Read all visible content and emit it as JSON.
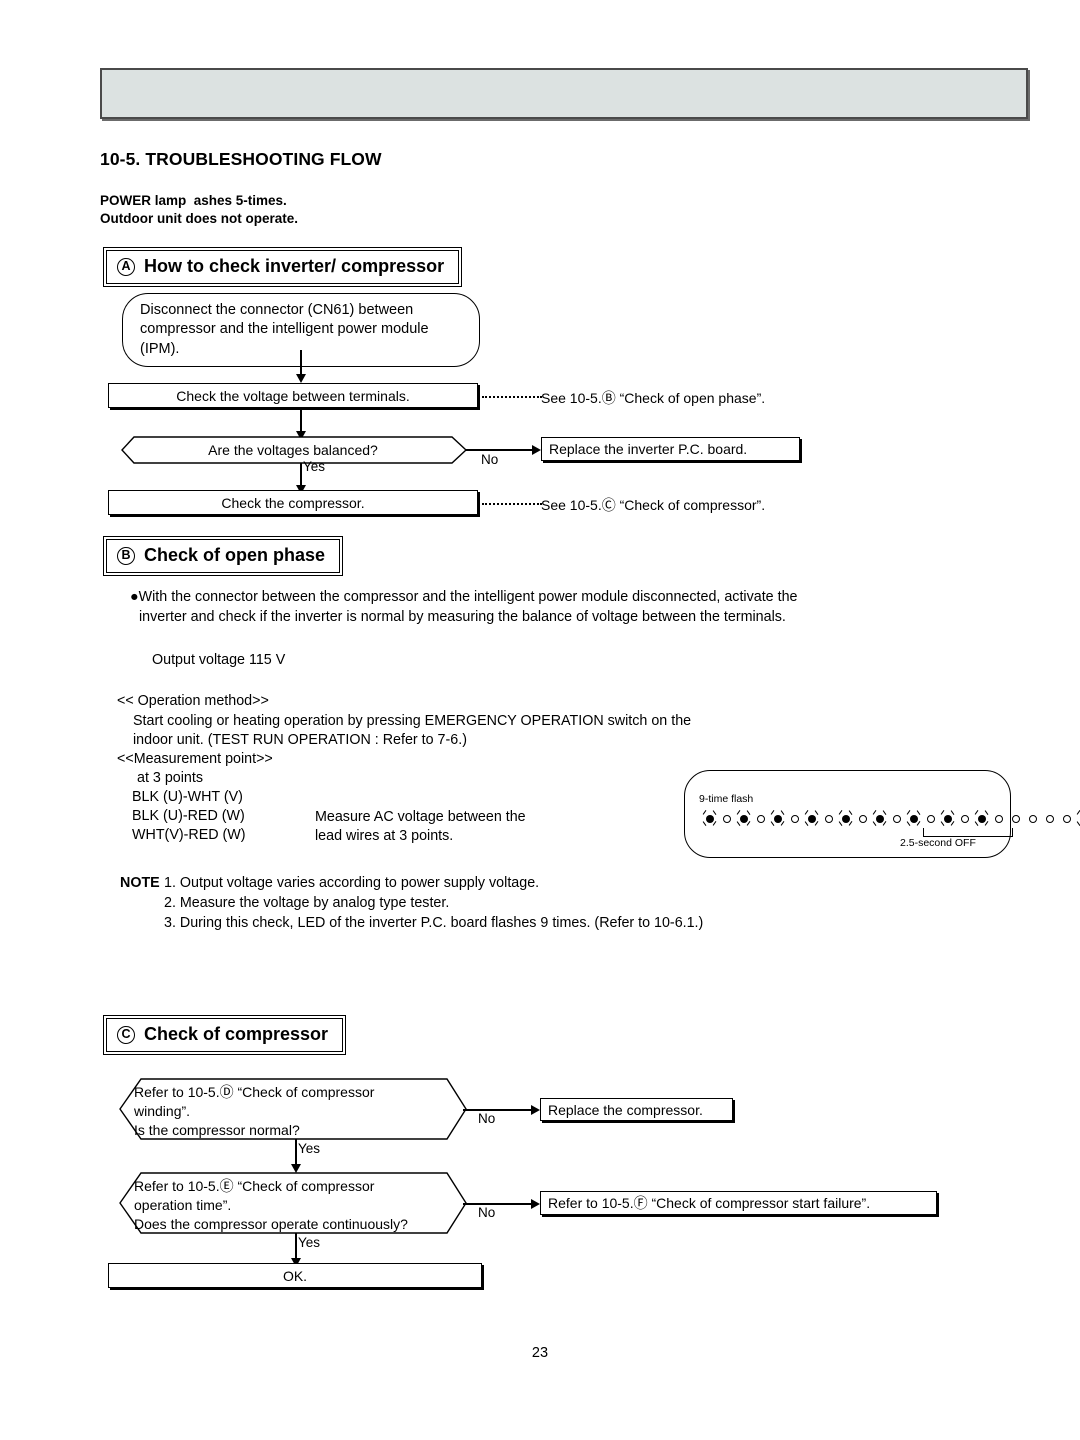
{
  "page": {
    "number": "23",
    "title": "10-5. TROUBLESHOOTING FLOW",
    "condition_line_1": "POWER lamp  ashes 5-times.",
    "condition_line_2": "Outdoor unit does not operate."
  },
  "colors": {
    "header_bar_fill": "#dce2e1",
    "header_bar_border": "#4a4a4a",
    "line": "#000000",
    "page_background": "#ffffff"
  },
  "section_a": {
    "marker": "A",
    "title": "How to check inverter/ compressor",
    "start_box": "Disconnect the connector (CN61) between\ncompressor and the intelligent power module\n(IPM).",
    "step_1": "Check the voltage between terminals.",
    "step_1_ref": "See 10-5.Ⓑ “Check of open phase”.",
    "decision_1": "Are the voltages balanced?",
    "decision_1_no": "No",
    "decision_1_yes": "Yes",
    "no_branch_box": "Replace the inverter P.C. board.",
    "step_2": "Check the compressor.",
    "step_2_ref": "See 10-5.Ⓒ “Check of compressor”."
  },
  "section_b": {
    "marker": "B",
    "title": "Check of open phase",
    "bullet": "●With the connector between the compressor and the intelligent power module disconnected, activate the inverter and check if the inverter is normal by measuring the balance of voltage between the terminals.",
    "output_voltage": "Output voltage 115 V",
    "operation_method_heading": "<< Operation method>>",
    "operation_line_1": "Start cooling or heating operation by pressing EMERGENCY OPERATION switch on the",
    "operation_line_2": "indoor unit. (TEST RUN OPERATION : Refer to 7-6.)",
    "measurement_point_heading": "<<Measurement point>>",
    "measurement_at": "at 3 points",
    "measurement_points": [
      "BLK (U)-WHT (V)",
      "BLK (U)-RED (W)",
      "WHT(V)-RED (W)"
    ],
    "measure_note_line_1": "Measure AC voltage between the",
    "measure_note_line_2": "lead wires at 3 points.",
    "led_diagram": {
      "caption": "9-time flash",
      "bracket_label": "2.5-second OFF",
      "flash_count": 9,
      "off_gap_count": 5,
      "pattern": [
        "on",
        "off",
        "on",
        "off",
        "on",
        "off",
        "on",
        "off",
        "on",
        "off",
        "on",
        "off",
        "on",
        "off",
        "on",
        "off",
        "on",
        "off",
        "off",
        "off",
        "off",
        "off",
        "on"
      ]
    },
    "notes": {
      "label": "NOTE",
      "items": [
        "1. Output voltage varies according to power supply voltage.",
        "2. Measure the voltage by analog type tester.",
        "3. During this check, LED of the inverter P.C. board flashes 9 times. (Refer to 10-6.1.)"
      ]
    }
  },
  "section_c": {
    "marker": "C",
    "title": "Check of compressor",
    "decision_1": "Refer to 10-5.Ⓓ “Check of compressor\nwinding”.\nIs the compressor normal?",
    "decision_1_no": "No",
    "decision_1_yes": "Yes",
    "no_branch_box_1": "Replace the compressor.",
    "decision_2": "Refer to 10-5.Ⓔ “Check of compressor\noperation time”.\nDoes the compressor operate continuously?",
    "decision_2_no": "No",
    "decision_2_yes": "Yes",
    "no_branch_box_2": "Refer to 10-5.Ⓕ “Check of compressor start failure”.",
    "end_box": "OK."
  }
}
